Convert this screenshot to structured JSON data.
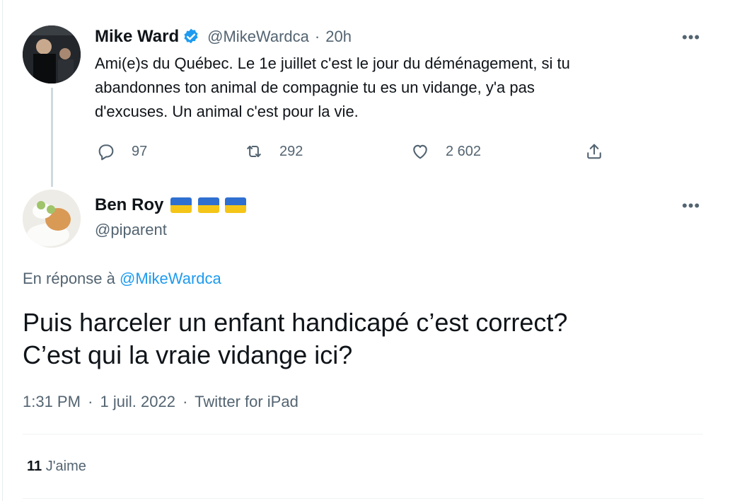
{
  "parent_tweet": {
    "display_name": "Mike Ward",
    "verified": true,
    "handle": "@MikeWardca",
    "separator": "·",
    "time": "20h",
    "text": "Ami(e)s du Québec. Le 1e juillet c'est le jour du déménagement, si tu abandonnes ton animal de compagnie tu es un vidange, y'a pas d'excuses. Un animal c'est pour la vie.",
    "text_lines": [
      "Ami(e)s du Québec. Le 1e juillet c'est le jour du déménagement, si tu",
      "abandonnes ton animal de compagnie tu es un vidange, y'a pas",
      "d'excuses. Un animal c'est pour la vie."
    ],
    "actions": {
      "replies": "97",
      "retweets": "292",
      "likes": "2 602"
    },
    "more_label": "•••"
  },
  "reply_tweet": {
    "display_name": "Ben Roy",
    "flags": [
      "ukraine-flag",
      "ukraine-flag",
      "ukraine-flag"
    ],
    "handle": "@piparent",
    "more_label": "•••",
    "reply_prefix": "En réponse à",
    "reply_to_handle": "@MikeWardca",
    "text_lines": [
      "Puis harceler un enfant handicapé c’est correct?",
      "C’est qui la vraie vidange ici?"
    ],
    "meta": {
      "time": "1:31 PM",
      "sep1": "·",
      "date": "1 juil. 2022",
      "sep2": "·",
      "source": "Twitter for iPad"
    },
    "likes_count": "11",
    "likes_label": "J'aime"
  },
  "colors": {
    "link": "#1d9bf0",
    "muted": "#536471",
    "text": "#0f1419",
    "verified": "#1d9bf0",
    "flag_blue": "#2f6fd0",
    "flag_yellow": "#f5c518"
  },
  "icons": [
    "verified-badge-icon",
    "reply-icon",
    "retweet-icon",
    "like-icon",
    "share-icon",
    "more-icon"
  ]
}
